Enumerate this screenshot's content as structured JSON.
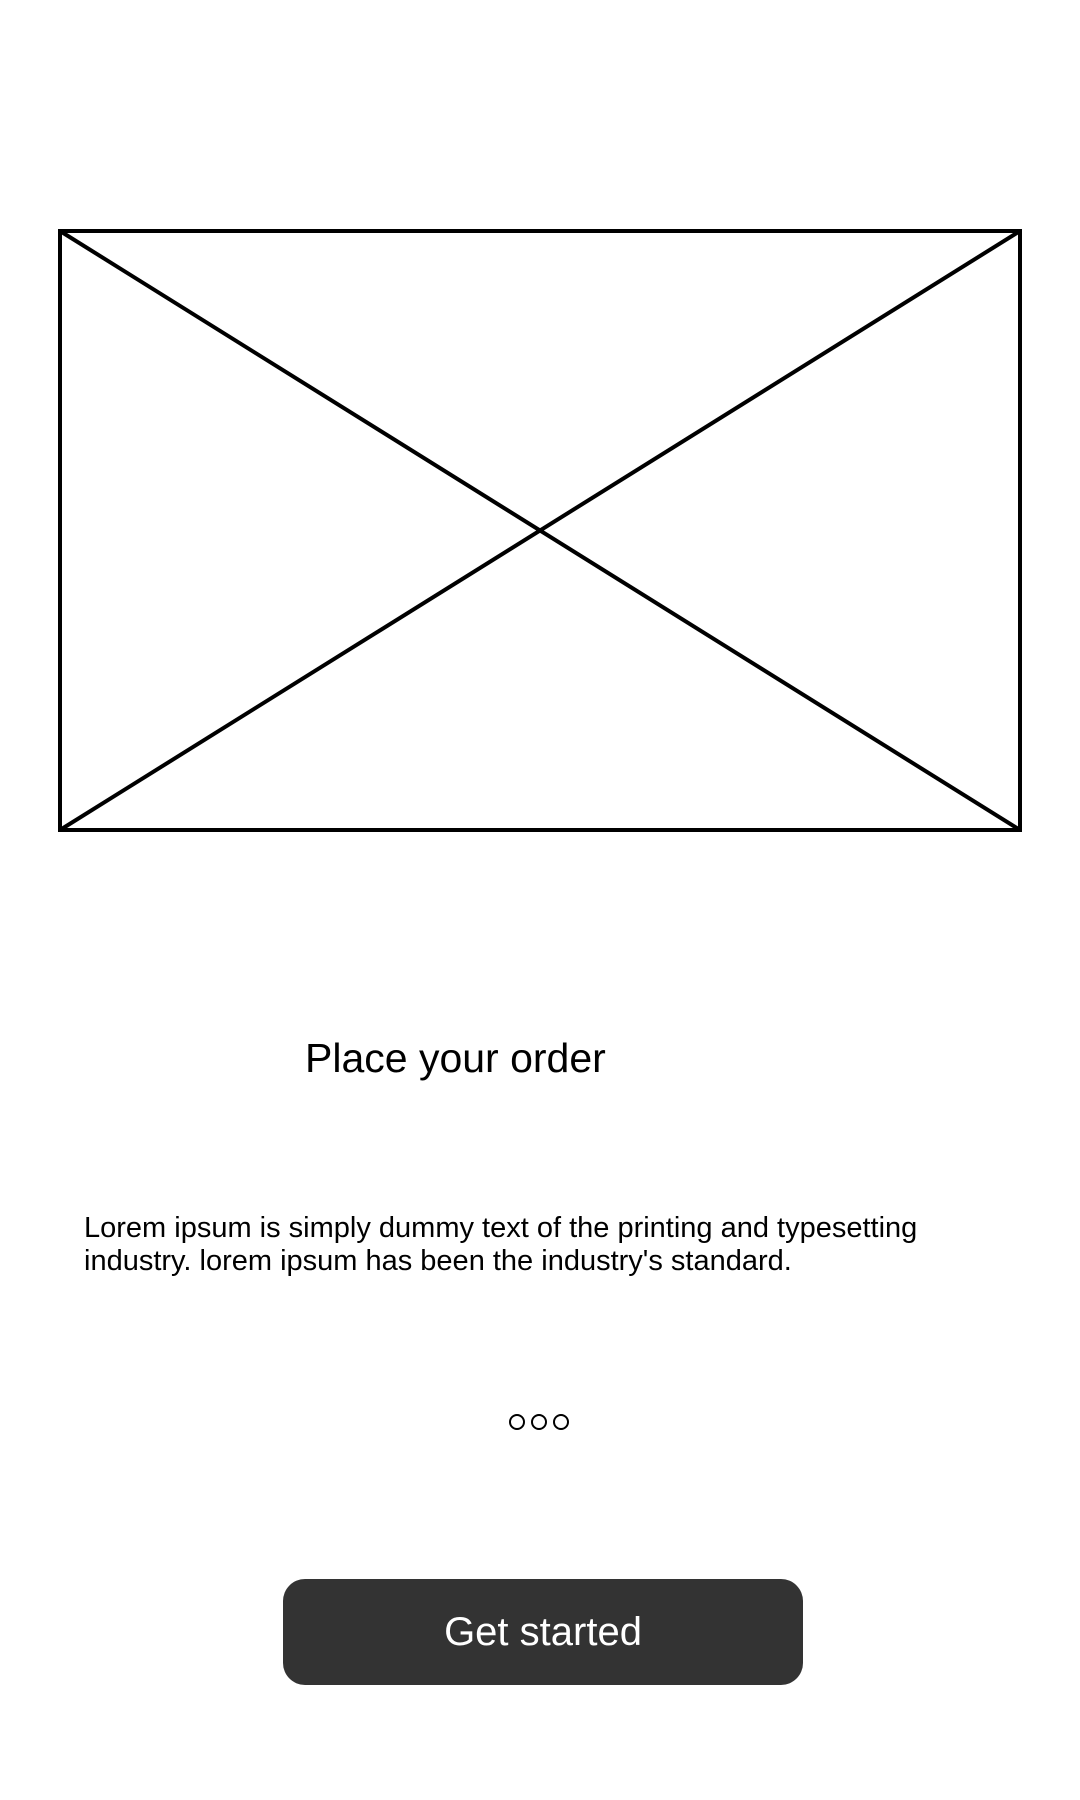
{
  "onboarding": {
    "title": "Place your order",
    "description": "Lorem ipsum is simply dummy text of the printing and typesetting industry. lorem ipsum has been the industry's standard.",
    "pager": {
      "count": 3,
      "active_index": null
    },
    "cta": {
      "label": "Get started"
    }
  },
  "theme": {
    "button_background": "#333333",
    "button_text": "#ffffff",
    "outline": "#000000",
    "background": "#ffffff"
  }
}
